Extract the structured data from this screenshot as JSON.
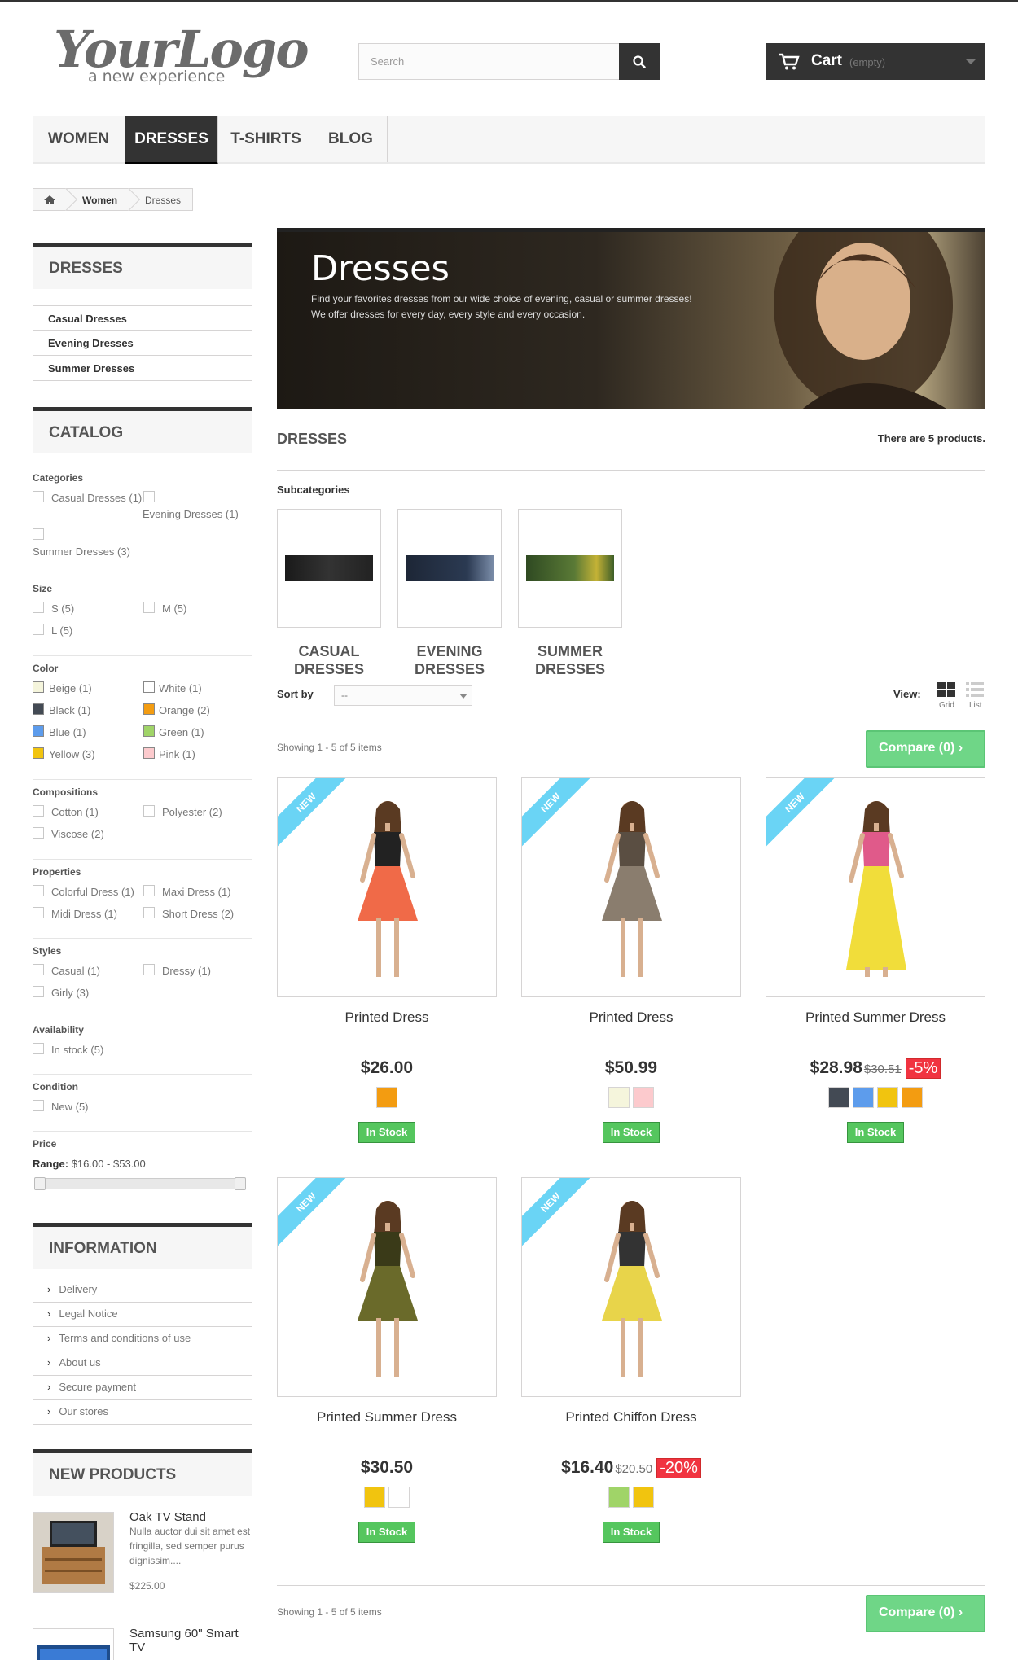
{
  "header": {
    "logo_text": "YourLogo",
    "logo_tagline": "a new experience",
    "search_placeholder": "Search",
    "cart_label": "Cart",
    "cart_status": "(empty)"
  },
  "menu": [
    "WOMEN",
    "DRESSES",
    "T-SHIRTS",
    "BLOG"
  ],
  "breadcrumb": [
    "Women",
    "Dresses"
  ],
  "sidebar": {
    "dresses_title": "DRESSES",
    "dresses_links": [
      "Casual Dresses",
      "Evening Dresses",
      "Summer Dresses"
    ],
    "catalog_title": "CATALOG",
    "filters": {
      "categories_h": "Categories",
      "categories": [
        "Casual Dresses (1)",
        "Evening Dresses (1)",
        "Summer Dresses (3)"
      ],
      "size_h": "Size",
      "sizes": [
        "S (5)",
        "M (5)",
        "L (5)"
      ],
      "color_h": "Color",
      "colors": [
        {
          "label": "Beige (1)",
          "color": "#f5f5dc"
        },
        {
          "label": "White (1)",
          "color": "#ffffff"
        },
        {
          "label": "Black (1)",
          "color": "#434a54"
        },
        {
          "label": "Orange (2)",
          "color": "#f39c11"
        },
        {
          "label": "Blue (1)",
          "color": "#5d9cec"
        },
        {
          "label": "Green (1)",
          "color": "#a0d468"
        },
        {
          "label": "Yellow (3)",
          "color": "#f1c40f"
        },
        {
          "label": "Pink (1)",
          "color": "#fccacd"
        }
      ],
      "compositions_h": "Compositions",
      "compositions": [
        "Cotton (1)",
        "Polyester (2)",
        "Viscose (2)"
      ],
      "properties_h": "Properties",
      "properties": [
        "Colorful Dress (1)",
        "Maxi Dress (1)",
        "Midi Dress (1)",
        "Short Dress (2)"
      ],
      "styles_h": "Styles",
      "styles": [
        "Casual (1)",
        "Dressy (1)",
        "Girly (3)"
      ],
      "availability_h": "Availability",
      "availability": [
        "In stock (5)"
      ],
      "condition_h": "Condition",
      "condition": [
        "New (5)"
      ],
      "price_h": "Price",
      "range_label": "Range:",
      "range_value": "$16.00 - $53.00"
    },
    "information_title": "INFORMATION",
    "information_links": [
      "Delivery",
      "Legal Notice",
      "Terms and conditions of use",
      "About us",
      "Secure payment",
      "Our stores"
    ],
    "new_products_title": "NEW PRODUCTS",
    "new_products": [
      {
        "name": "Oak TV Stand",
        "desc": "Nulla auctor dui sit amet est fringilla, sed semper purus dignissim....",
        "price": "$225.00"
      },
      {
        "name": "Samsung 60\" Smart TV",
        "desc": "",
        "price": ""
      }
    ]
  },
  "main": {
    "banner_title": "Dresses",
    "banner_line1": "Find your favorites dresses from our wide choice of evening, casual or summer dresses!",
    "banner_line2": "We offer dresses for every day, every style and every occasion.",
    "heading": "DRESSES",
    "count_text": "There are 5 products.",
    "subcategories_h": "Subcategories",
    "subcategories": [
      {
        "line1": "CASUAL",
        "line2": "DRESSES"
      },
      {
        "line1": "EVENING",
        "line2": "DRESSES"
      },
      {
        "line1": "SUMMER",
        "line2": "DRESSES"
      }
    ],
    "sort_label": "Sort by",
    "sort_value": "--",
    "view_label": "View:",
    "view_grid": "Grid",
    "view_list": "List",
    "showing_text": "Showing 1 - 5 of 5 items",
    "compare_label": "Compare (0)",
    "products": [
      {
        "name": "Printed Dress",
        "price": "$26.00",
        "old_price": "",
        "discount": "",
        "colors": [
          "#f39c11"
        ],
        "stock": "In Stock",
        "badge": "NEW"
      },
      {
        "name": "Printed Dress",
        "price": "$50.99",
        "old_price": "",
        "discount": "",
        "colors": [
          "#f5f5dc",
          "#fccacd"
        ],
        "stock": "In Stock",
        "badge": "NEW"
      },
      {
        "name": "Printed Summer Dress",
        "price": "$28.98",
        "old_price": "$30.51",
        "discount": "-5%",
        "colors": [
          "#434a54",
          "#5d9cec",
          "#f1c40f",
          "#f39c11"
        ],
        "stock": "In Stock",
        "badge": "NEW"
      },
      {
        "name": "Printed Summer Dress",
        "price": "$30.50",
        "old_price": "",
        "discount": "",
        "colors": [
          "#f1c40f",
          "#ffffff"
        ],
        "stock": "In Stock",
        "badge": "NEW"
      },
      {
        "name": "Printed Chiffon Dress",
        "price": "$16.40",
        "old_price": "$20.50",
        "discount": "-20%",
        "colors": [
          "#a0d468",
          "#f1c40f"
        ],
        "stock": "In Stock",
        "badge": "NEW"
      }
    ]
  }
}
